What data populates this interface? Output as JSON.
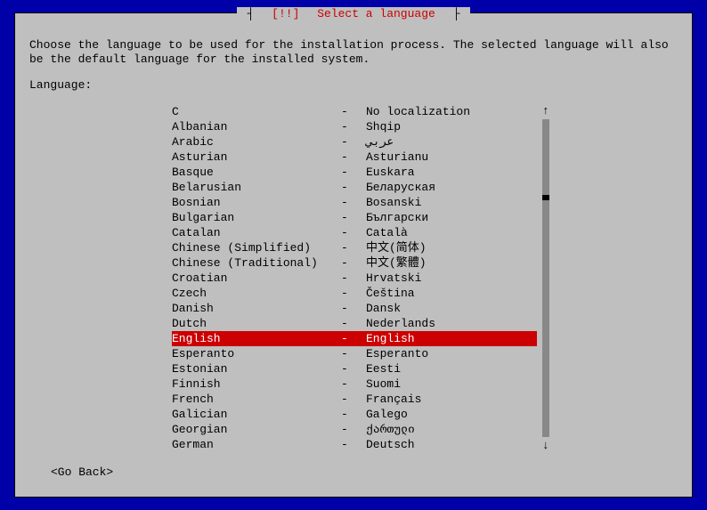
{
  "dialog": {
    "title_prefix": "┤ ",
    "title_marker": "[!!]",
    "title_text": " Select a language",
    "title_suffix": " ├",
    "instruction": "Choose the language to be used for the installation process. The selected language will also be the default language for the installed system.",
    "lang_label": "Language:",
    "go_back": "<Go Back>",
    "scroll_up": "↑",
    "scroll_down": "↓"
  },
  "languages": [
    {
      "name": "C",
      "native": "No localization",
      "selected": false
    },
    {
      "name": "Albanian",
      "native": "Shqip",
      "selected": false
    },
    {
      "name": "Arabic",
      "native": "عربي",
      "selected": false
    },
    {
      "name": "Asturian",
      "native": "Asturianu",
      "selected": false
    },
    {
      "name": "Basque",
      "native": "Euskara",
      "selected": false
    },
    {
      "name": "Belarusian",
      "native": "Беларуская",
      "selected": false
    },
    {
      "name": "Bosnian",
      "native": "Bosanski",
      "selected": false
    },
    {
      "name": "Bulgarian",
      "native": "Български",
      "selected": false
    },
    {
      "name": "Catalan",
      "native": "Català",
      "selected": false
    },
    {
      "name": "Chinese (Simplified)",
      "native": "中文(简体)",
      "selected": false
    },
    {
      "name": "Chinese (Traditional)",
      "native": "中文(繁體)",
      "selected": false
    },
    {
      "name": "Croatian",
      "native": "Hrvatski",
      "selected": false
    },
    {
      "name": "Czech",
      "native": "Čeština",
      "selected": false
    },
    {
      "name": "Danish",
      "native": "Dansk",
      "selected": false
    },
    {
      "name": "Dutch",
      "native": "Nederlands",
      "selected": false
    },
    {
      "name": "English",
      "native": "English",
      "selected": true
    },
    {
      "name": "Esperanto",
      "native": "Esperanto",
      "selected": false
    },
    {
      "name": "Estonian",
      "native": "Eesti",
      "selected": false
    },
    {
      "name": "Finnish",
      "native": "Suomi",
      "selected": false
    },
    {
      "name": "French",
      "native": "Français",
      "selected": false
    },
    {
      "name": "Galician",
      "native": "Galego",
      "selected": false
    },
    {
      "name": "Georgian",
      "native": "ქართული",
      "selected": false
    },
    {
      "name": "German",
      "native": "Deutsch",
      "selected": false
    }
  ]
}
